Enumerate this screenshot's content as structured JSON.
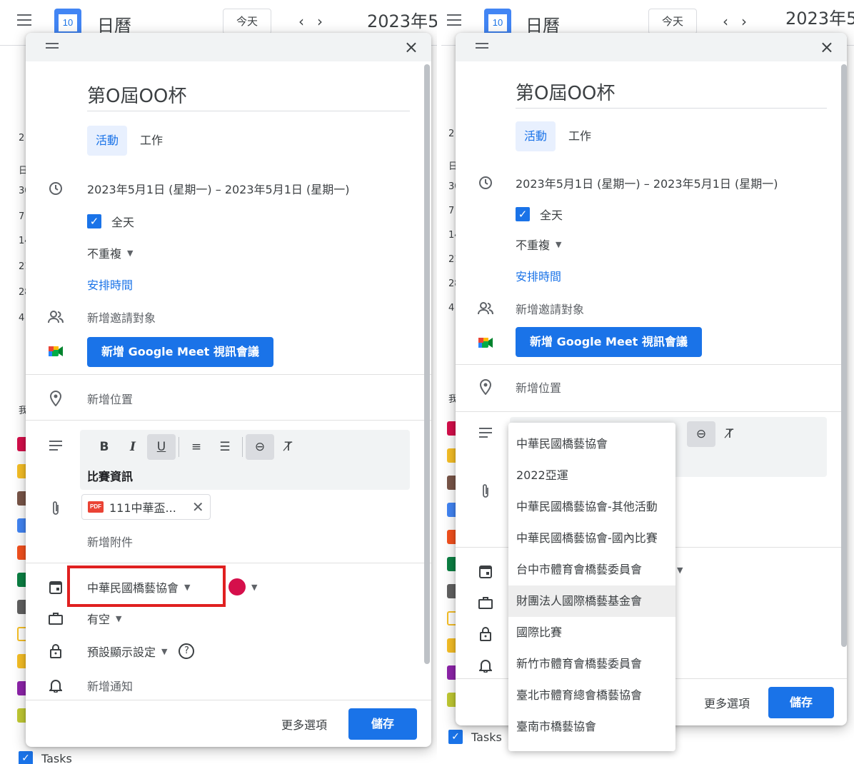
{
  "app": {
    "title": "日曆",
    "logo_day": "10",
    "today_label": "今天",
    "nav_prev": "‹",
    "nav_next": "›",
    "date_label_left": "2023年5",
    "date_label_right": "2023年5",
    "tasks_label": "Tasks"
  },
  "dialog": {
    "title": "第O屆OO杯",
    "tabs": [
      "活動",
      "工作"
    ],
    "date_range": "2023年5月1日 (星期一)  –  2023年5月1日 (星期一)",
    "all_day_label": "全天",
    "repeat_label": "不重複",
    "find_time_link": "安排時間",
    "add_guests": "新增邀請對象",
    "meet_button": "新增 Google Meet 視訊會議",
    "add_location": "新增位置",
    "toolbar": {
      "bold": "B",
      "italic": "I",
      "underline": "U",
      "numbered_list": "≡",
      "bullet_list": "☰",
      "link": "⊖",
      "clear_format": "T̸"
    },
    "description": "比賽資訊",
    "attachment_name": "111中華盃...",
    "attachment_type": "PDF",
    "add_attachment": "新增附件",
    "calendar_select": "中華民國橋藝協會",
    "availability": "有空",
    "visibility": "預設顯示設定",
    "add_notification": "新增通知",
    "more_options": "更多選項",
    "save": "儲存",
    "close": "×",
    "help": "?"
  },
  "calendar_dropdown": {
    "options": [
      "中華民國橋藝協會",
      "2022亞運",
      "中華民國橋藝協會-其他活動",
      "中華民國橋藝協會-國內比賽",
      "台中市體育會橋藝委員會",
      "財團法人國際橋藝基金會",
      "國際比賽",
      "新竹市體育會橋藝委員會",
      "臺北市體育總會橋藝協會",
      "臺南市橋藝協會"
    ],
    "hovered_index": 5
  },
  "colors": {
    "accent": "#1a73e8",
    "event_color": "#d50f4b",
    "highlight_box": "#e02020"
  },
  "background_strip": {
    "left_numbers": [
      "2",
      "日",
      "30",
      "7",
      "14",
      "21",
      "28",
      "4"
    ],
    "right_numbers": [
      "2",
      "日",
      "30",
      "7",
      "14",
      "21",
      "28",
      "4"
    ],
    "left_label": "我",
    "right_label": "我",
    "swatch_colors": [
      "#d50f4b",
      "#f6bf26",
      "#795548",
      "#4285f4",
      "#f4511e",
      "#0b8043",
      "#616161",
      "#f6bf26",
      "#f6bf26",
      "#8e24aa",
      "#c0ca33"
    ]
  }
}
